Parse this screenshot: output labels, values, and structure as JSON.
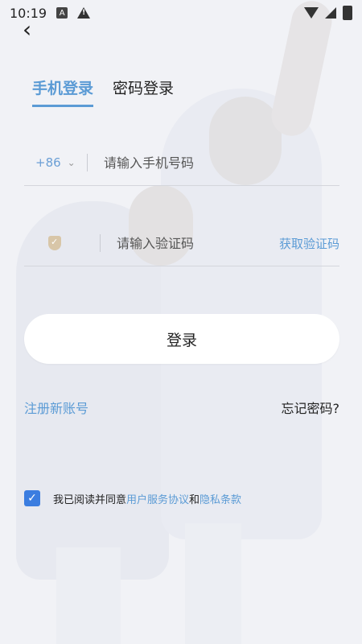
{
  "status_bar": {
    "time": "10:19",
    "icons": [
      "font-icon",
      "warning-icon",
      "wifi-icon",
      "signal-icon",
      "battery-icon"
    ]
  },
  "nav": {
    "back_icon": "chevron-left-icon",
    "back_glyph": "‹"
  },
  "tabs": [
    {
      "label": "手机登录",
      "active": true
    },
    {
      "label": "密码登录",
      "active": false
    }
  ],
  "phone": {
    "country_code": "+86",
    "chevron_glyph": "⌄",
    "placeholder": "请输入手机号码"
  },
  "code": {
    "placeholder": "请输入验证码",
    "get_code_label": "获取验证码",
    "icon": "shield-check-icon"
  },
  "login_button": "登录",
  "links": {
    "register": "注册新账号",
    "forgot_password": "忘记密码?"
  },
  "agreement": {
    "checked": true,
    "check_glyph": "✓",
    "prefix": "我已阅读并同意",
    "terms": "用户服务协议",
    "and": "和",
    "privacy": "隐私条款"
  },
  "colors": {
    "accent": "#5b9bd5",
    "checkbox": "#3b7de0",
    "background": "#f1f2f6",
    "button_bg": "#ffffff"
  }
}
